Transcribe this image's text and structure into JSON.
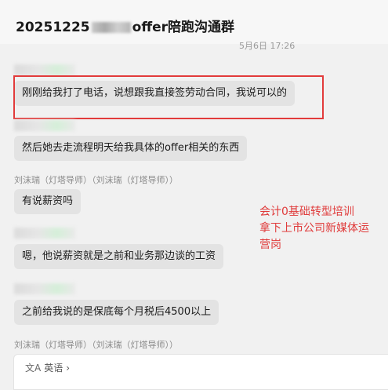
{
  "header": {
    "title_prefix": "20251225",
    "title_suffix": "offer陪跑沟通群"
  },
  "timestamp": "5月6日 17:26",
  "messages": [
    {
      "text": "刚刚给我打了电话，说想跟我直接签劳动合同，我说可以的"
    },
    {
      "text": "然后她去走流程明天给我具体的offer相关的东西"
    },
    {
      "sender": "刘沫瑞（灯塔导师）（刘沫瑞（灯塔导师））",
      "text": "有说薪资吗"
    },
    {
      "text": "嗯，他说薪资就是之前和业务那边谈的工资"
    },
    {
      "text": "之前给我说的是保底每个月税后4500以上"
    }
  ],
  "last_sender": "刘沫瑞（灯塔导师）（刘沫瑞（灯塔导师））",
  "annotation": {
    "line1": "会计0基础转型培训",
    "line2": "拿下上市公司新媒体运",
    "line3": "营岗",
    "color": "#e03c3c"
  },
  "input": {
    "translate_label": "英语",
    "translate_icon": "translate-icon"
  }
}
